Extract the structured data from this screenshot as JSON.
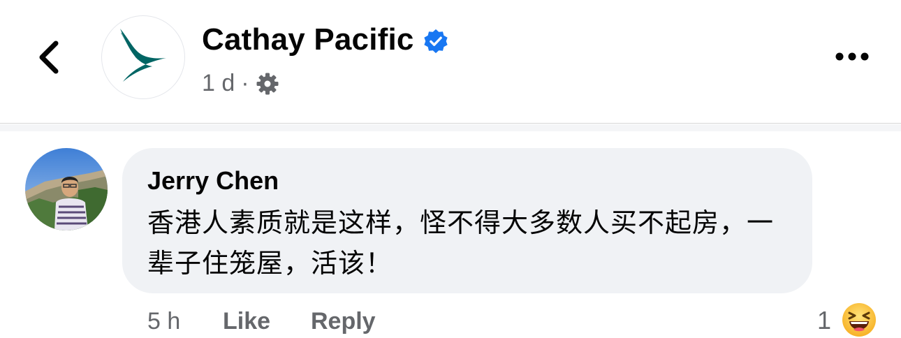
{
  "post": {
    "page_name": "Cathay Pacific",
    "time": "1 d",
    "separator": "·",
    "verified_icon": "verified-badge-icon",
    "privacy_icon": "gear-icon"
  },
  "comment": {
    "author": "Jerry Chen",
    "text": "香港人素质就是这样，怪不得大多数人买不起房，一辈子住笼屋，活该！",
    "time": "5 h",
    "like_label": "Like",
    "reply_label": "Reply",
    "reaction_count": "1",
    "reaction_icon": "laughing-emoji-icon"
  },
  "colors": {
    "verified": "#1877f2",
    "brand_teal": "#006564",
    "bubble_bg": "#f0f2f5",
    "secondary_text": "#65676b"
  }
}
